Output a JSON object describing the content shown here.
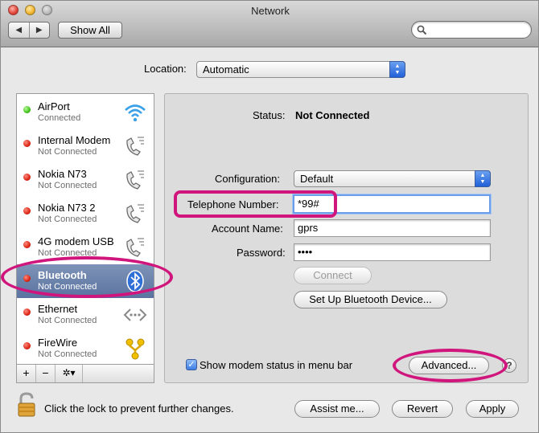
{
  "window": {
    "title": "Network"
  },
  "toolbar": {
    "back_glyph": "◀",
    "forward_glyph": "▶",
    "show_all": "Show All",
    "search_placeholder": ""
  },
  "location": {
    "label": "Location:",
    "value": "Automatic"
  },
  "sidebar": {
    "items": [
      {
        "name": "AirPort",
        "status": "Connected",
        "dot": "green",
        "icon": "wifi-icon"
      },
      {
        "name": "Internal Modem",
        "status": "Not Connected",
        "dot": "red",
        "icon": "phone-icon"
      },
      {
        "name": "Nokia N73",
        "status": "Not Connected",
        "dot": "red",
        "icon": "phone-icon"
      },
      {
        "name": "Nokia N73 2",
        "status": "Not Connected",
        "dot": "red",
        "icon": "phone-icon"
      },
      {
        "name": "4G modem USB",
        "status": "Not Connected",
        "dot": "red",
        "icon": "phone-icon"
      },
      {
        "name": "Bluetooth",
        "status": "Not Connected",
        "dot": "red",
        "icon": "bluetooth-icon"
      },
      {
        "name": "Ethernet",
        "status": "Not Connected",
        "dot": "red",
        "icon": "ethernet-icon"
      },
      {
        "name": "FireWire",
        "status": "Not Connected",
        "dot": "red",
        "icon": "firewire-icon"
      }
    ],
    "selected_index": 5,
    "add": "+",
    "remove": "−",
    "action": "✲▾"
  },
  "detail": {
    "status_label": "Status:",
    "status_value": "Not Connected",
    "configuration_label": "Configuration:",
    "configuration_value": "Default",
    "telephone_label": "Telephone Number:",
    "telephone_value": "*99#",
    "account_label": "Account Name:",
    "account_value": "gprs",
    "password_label": "Password:",
    "password_value": "••••",
    "connect_button": "Connect",
    "setup_button": "Set Up Bluetooth Device...",
    "show_status_label": "Show modem status in menu bar",
    "show_status_checked": true,
    "advanced_button": "Advanced...",
    "help": "?"
  },
  "footer": {
    "lock_text": "Click the lock to prevent further changes.",
    "assist_button": "Assist me...",
    "revert_button": "Revert",
    "apply_button": "Apply"
  },
  "colors": {
    "annotation": "#d0157d",
    "selection": "#6b82ac",
    "accent_blue": "#3d7ee6"
  }
}
